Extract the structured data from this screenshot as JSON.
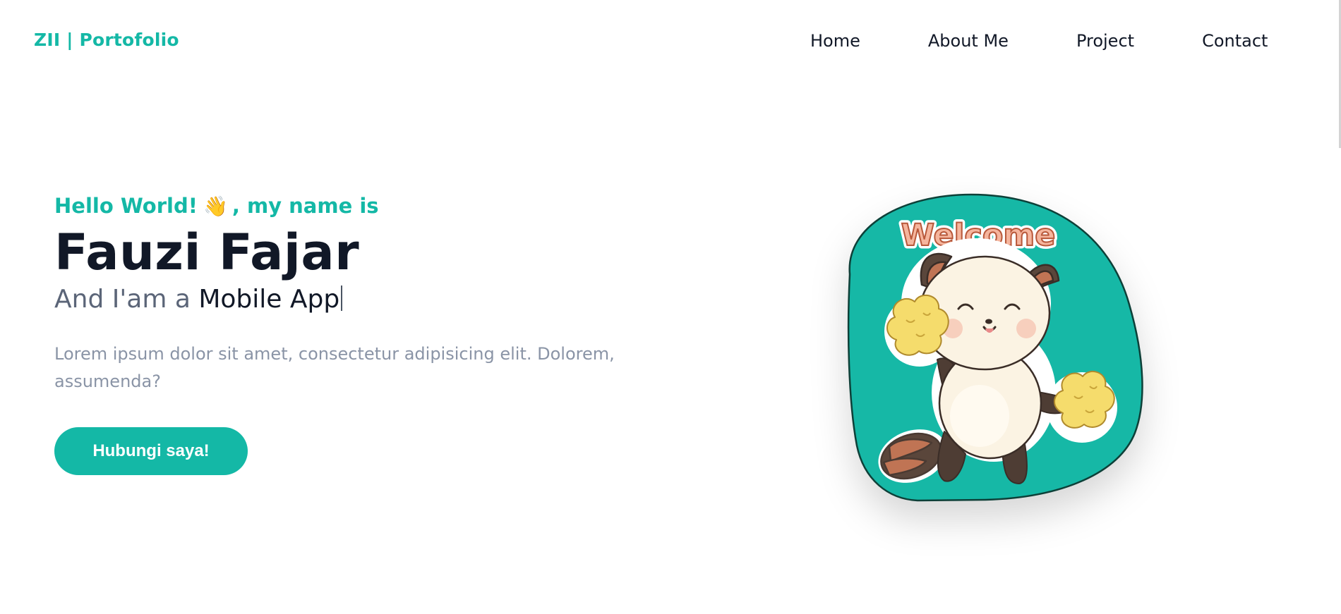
{
  "header": {
    "brand": "ZII | Portofolio",
    "nav": [
      {
        "label": "Home"
      },
      {
        "label": "About Me"
      },
      {
        "label": "Project"
      },
      {
        "label": "Contact"
      }
    ]
  },
  "hero": {
    "greeting_prefix": "Hello World!",
    "greeting_emoji": "👋",
    "greeting_suffix": ", my name is",
    "name": "Fauzi Fajar",
    "role_prefix": "And I'am a",
    "role": "Mobile App",
    "description": "Lorem ipsum dolor sit amet, consectetur adipisicing elit. Dolorem, assumenda?",
    "cta_label": "Hubungi saya!",
    "illustration": {
      "caption": "Welcome",
      "subject": "red-panda-cheerleader-sticker",
      "blob_color": "#14b8a6"
    }
  },
  "colors": {
    "accent": "#14b8a6",
    "heading": "#111827",
    "muted": "#8a94a6"
  }
}
